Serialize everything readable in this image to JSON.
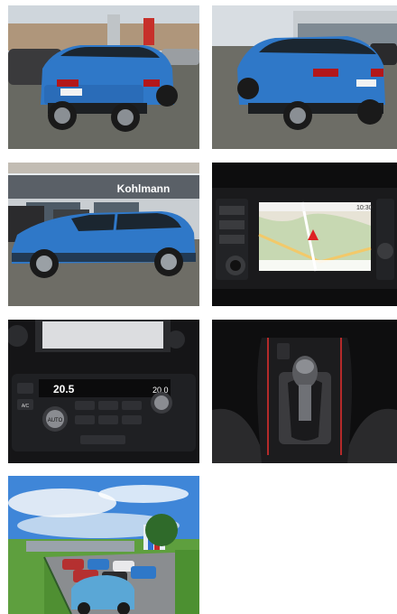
{
  "gallery": {
    "photos": [
      {
        "id": "photo-rear-left",
        "alt": "Rear left view of blue SUV"
      },
      {
        "id": "photo-rear-right",
        "alt": "Rear right view of blue SUV"
      },
      {
        "id": "photo-side-dealership",
        "alt": "Side view of blue SUV at dealership"
      },
      {
        "id": "photo-navigation",
        "alt": "Navigation screen"
      },
      {
        "id": "photo-climate",
        "alt": "Climate control panel"
      },
      {
        "id": "photo-gear-shift",
        "alt": "Gear shift"
      },
      {
        "id": "photo-lot",
        "alt": "Dealer lot"
      }
    ],
    "dealer_sign": "Kohlmann",
    "climate_left_temp": "20.5",
    "climate_right_temp": "20.0",
    "climate_auto_label": "AUTO",
    "climate_ac_label": "A/C",
    "nav_time": "10:30",
    "accent_color": "#2f78c8"
  }
}
